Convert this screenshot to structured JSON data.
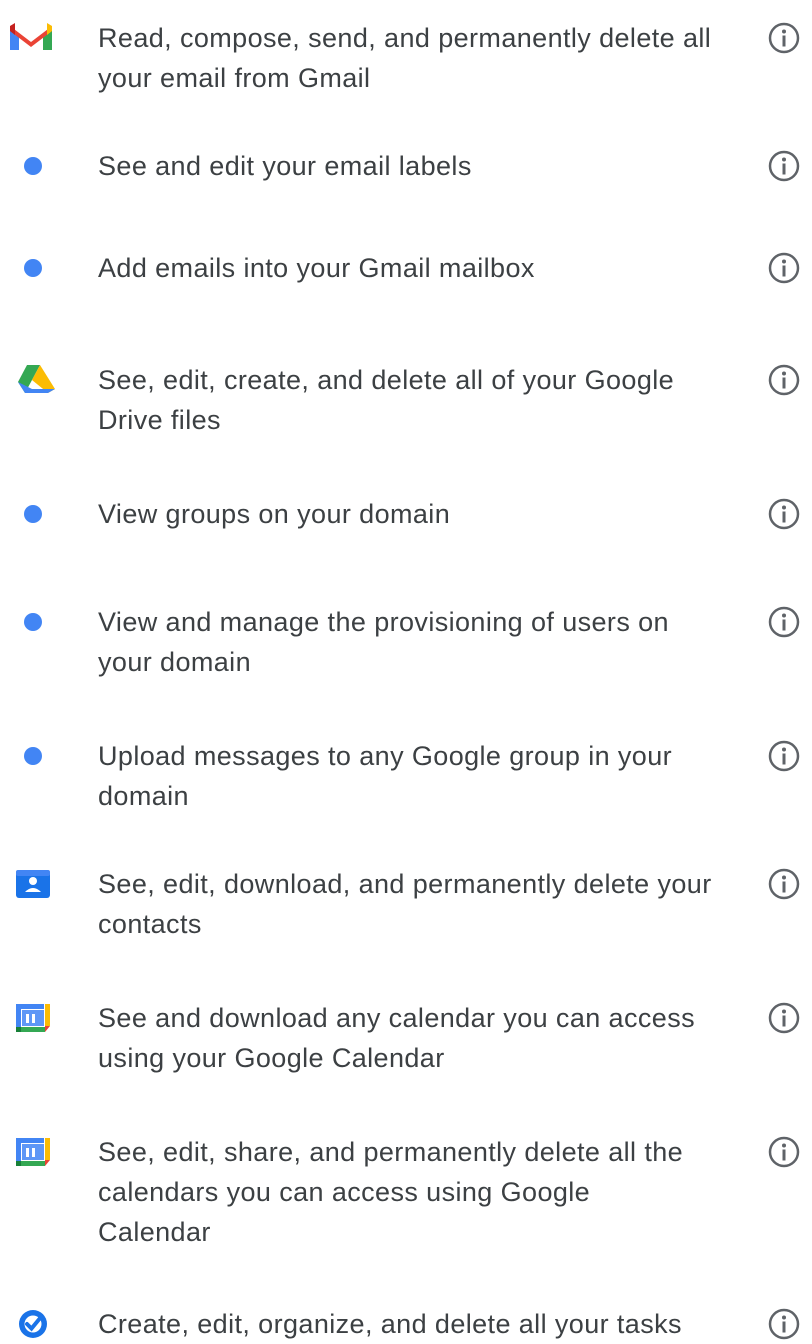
{
  "colors": {
    "google_blue": "#4285f4",
    "google_red": "#ea4335",
    "google_yellow": "#fbbc04",
    "google_green": "#34a853",
    "text": "#3c4043",
    "icon_gray": "#5f6368"
  },
  "permissions": [
    {
      "icon": "gmail-icon",
      "text": "Read, compose, send, and permanently delete all\nyour email from Gmail"
    },
    {
      "icon": "blue-dot-icon",
      "text": "See and edit your email labels"
    },
    {
      "icon": "blue-dot-icon",
      "text": "Add emails into your Gmail mailbox"
    },
    {
      "icon": "google-drive-icon",
      "text": "See, edit, create, and delete all of your Google\nDrive files"
    },
    {
      "icon": "blue-dot-icon",
      "text": "View groups on your domain"
    },
    {
      "icon": "blue-dot-icon",
      "text": "View and manage the provisioning of users on\nyour domain"
    },
    {
      "icon": "blue-dot-icon",
      "text": "Upload messages to any Google group in your\ndomain"
    },
    {
      "icon": "google-contacts-icon",
      "text": "See, edit, download, and permanently delete your\ncontacts"
    },
    {
      "icon": "google-calendar-icon",
      "text": "See and download any calendar you can access\nusing your Google Calendar"
    },
    {
      "icon": "google-calendar-icon",
      "text": "See, edit, share, and permanently delete all the\ncalendars you can access using Google\nCalendar"
    },
    {
      "icon": "google-tasks-icon",
      "text": "Create, edit, organize, and delete all your tasks"
    }
  ],
  "info_icon": "info-circle-icon"
}
